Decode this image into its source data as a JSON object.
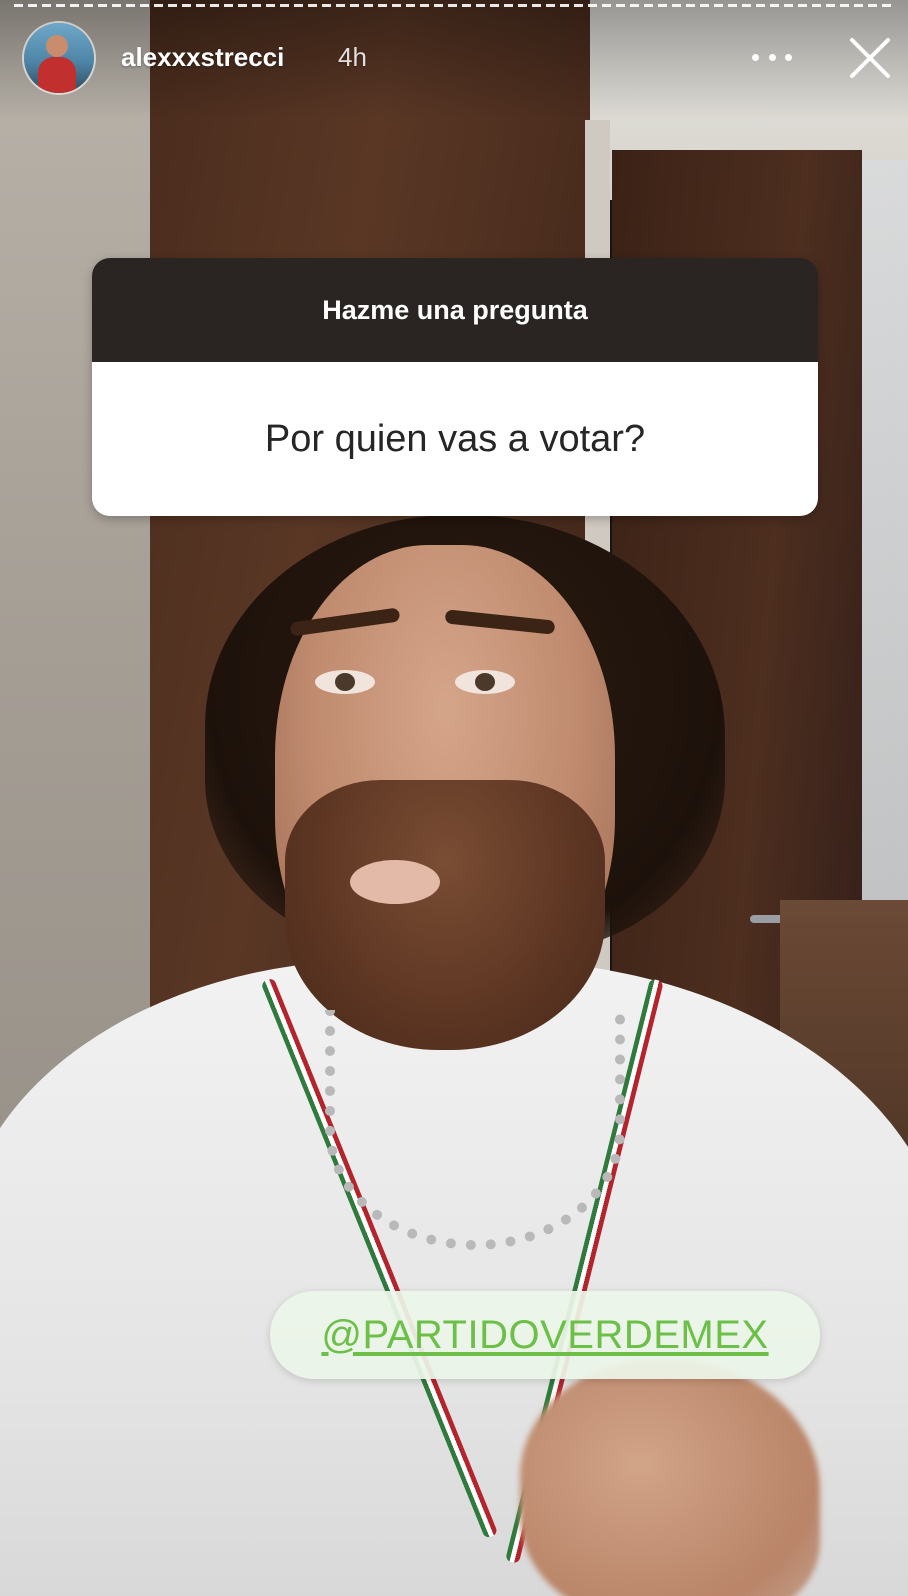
{
  "story": {
    "progress_segments": "multi-segment",
    "header": {
      "username": "alexxxstrecci",
      "timestamp": "4h",
      "more_icon": "more-horizontal-icon",
      "close_icon": "close-icon"
    },
    "question_sticker": {
      "title": "Hazme una pregunta",
      "question": "Por quien vas a votar?"
    },
    "mention_sticker": {
      "text": "@PARTIDOVERDEMEX",
      "color": "#6cbf47"
    }
  }
}
